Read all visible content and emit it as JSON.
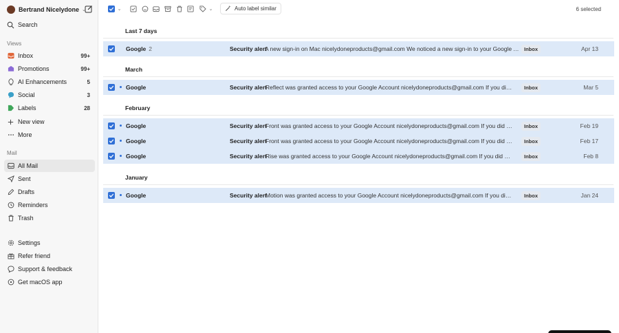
{
  "account": {
    "name": "Bertrand Nicelydone"
  },
  "sidebar": {
    "search_label": "Search",
    "views_section": "Views",
    "views": [
      {
        "label": "Inbox",
        "count": "99+",
        "icon": "inbox-icon",
        "color": "#e0673a"
      },
      {
        "label": "Promotions",
        "count": "99+",
        "icon": "promotions-icon",
        "color": "#8b6bd6"
      },
      {
        "label": "AI Enhancements",
        "count": "5",
        "icon": "ai-icon",
        "color": "#666666"
      },
      {
        "label": "Social",
        "count": "3",
        "icon": "social-icon",
        "color": "#3aa0c8"
      },
      {
        "label": "Labels",
        "count": "28",
        "icon": "labels-icon",
        "color": "#3fa65a"
      },
      {
        "label": "New view",
        "count": "",
        "icon": "plus-icon",
        "color": "#555555"
      },
      {
        "label": "More",
        "count": "",
        "icon": "more-icon",
        "color": "#555555"
      }
    ],
    "mail_section": "Mail",
    "mail": [
      {
        "label": "All Mail",
        "icon": "all-mail-icon"
      },
      {
        "label": "Sent",
        "icon": "sent-icon"
      },
      {
        "label": "Drafts",
        "icon": "drafts-icon"
      },
      {
        "label": "Reminders",
        "icon": "reminders-icon"
      },
      {
        "label": "Trash",
        "icon": "trash-icon"
      }
    ],
    "footer": [
      {
        "label": "Settings",
        "icon": "gear-icon"
      },
      {
        "label": "Refer friend",
        "icon": "refer-icon"
      },
      {
        "label": "Support & feedback",
        "icon": "support-icon"
      },
      {
        "label": "Get macOS app",
        "icon": "download-icon"
      }
    ]
  },
  "toolbar": {
    "auto_label": "Auto label similar",
    "selected": "6 selected"
  },
  "colors": {
    "accent": "#2f6fd6",
    "row_selected": "#dde9f8"
  },
  "groups": [
    {
      "header": "Last 7 days",
      "rows": [
        {
          "sender": "Google",
          "count": "2",
          "unread": false,
          "subject": "Security alert",
          "snippet": "A new sign-in on Mac nicelydoneproducts@gmail.com We noticed a new sign-in to your Google Account",
          "label": "Inbox",
          "date": "Apr 13"
        }
      ]
    },
    {
      "header": "March",
      "rows": [
        {
          "sender": "Google",
          "count": "",
          "unread": true,
          "subject": "Security alert",
          "snippet": "Reflect was granted access to your Google Account nicelydoneproducts@gmail.com If you did not grant",
          "label": "Inbox",
          "date": "Mar 5"
        }
      ]
    },
    {
      "header": "February",
      "rows": [
        {
          "sender": "Google",
          "count": "",
          "unread": true,
          "subject": "Security alert",
          "snippet": "Front was granted access to your Google Account nicelydoneproducts@gmail.com If you did not grant",
          "label": "Inbox",
          "date": "Feb 19"
        },
        {
          "sender": "Google",
          "count": "",
          "unread": true,
          "subject": "Security alert",
          "snippet": "Front was granted access to your Google Account nicelydoneproducts@gmail.com If you did not grant",
          "label": "Inbox",
          "date": "Feb 17"
        },
        {
          "sender": "Google",
          "count": "",
          "unread": true,
          "subject": "Security alert",
          "snippet": "Rise was granted access to your Google Account nicelydoneproducts@gmail.com If you did not grant",
          "label": "Inbox",
          "date": "Feb 8"
        }
      ]
    },
    {
      "header": "January",
      "rows": [
        {
          "sender": "Google",
          "count": "",
          "unread": true,
          "subject": "Security alert",
          "snippet": "Motion was granted access to your Google Account nicelydoneproducts@gmail.com If you did not grant",
          "label": "Inbox",
          "date": "Jan 24"
        }
      ]
    }
  ]
}
